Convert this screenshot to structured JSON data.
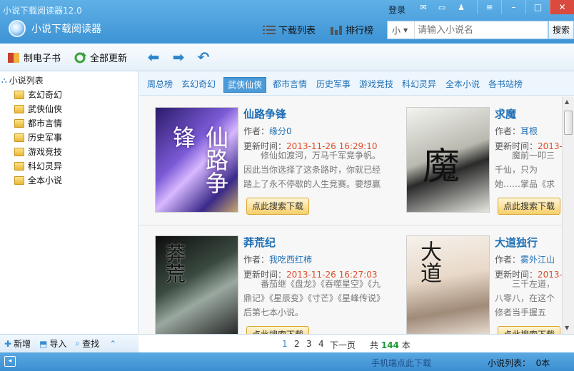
{
  "app": {
    "title": "小说下载阅读器12.0",
    "logo_text": "小说下载阅读器"
  },
  "topbar": {
    "login": "登录",
    "download_list": "下载列表",
    "ranking": "排行榜"
  },
  "search": {
    "type": "小",
    "placeholder": "请输入小说名",
    "button": "搜索"
  },
  "toolbar": {
    "make_ebook": "制电子书",
    "update_all": "全部更新"
  },
  "tree": {
    "root": "小说列表",
    "items": [
      "玄幻奇幻",
      "武侠仙侠",
      "都市言情",
      "历史军事",
      "游戏竞技",
      "科幻灵异",
      "全本小说"
    ]
  },
  "sidebar_bottom": {
    "add": "新增",
    "import": "导入",
    "find": "查找"
  },
  "categories": [
    "周总榜",
    "玄幻奇幻",
    "武侠仙侠",
    "都市言情",
    "历史军事",
    "游戏竞技",
    "科幻灵异",
    "全本小说",
    "各书站榜"
  ],
  "active_category": "武侠仙侠",
  "labels": {
    "author": "作者：",
    "updated": "更新时间：",
    "download": "点此搜索下载"
  },
  "books": [
    {
      "title": "仙路争锋",
      "author": "缘分0",
      "updated": "2013-11-26 16:29:10",
      "desc": "修仙如渡河，万马千军竞争帆。因此当你选择了这条路时，你就已经踏上了永不停歇的人生竞赛。要想赢"
    },
    {
      "title": "求魔",
      "author": "耳根",
      "updated": "2013-",
      "desc": "魔前一叩三千仙，只为她……掌品《求魔》"
    },
    {
      "title": "莽荒纪",
      "author": "我吃西红柿",
      "updated": "2013-11-26 16:27:03",
      "desc": "番茄继《盘龙》《吞噬星空》《九鼎记》《星辰变》《寸芒》《星峰传说》后第七本小说。"
    },
    {
      "title": "大道独行",
      "author": "雾外江山",
      "updated": "2013-",
      "desc": "三千左道，八零八，在这个修者当手握五行，脚踏"
    }
  ],
  "pager": {
    "pages": [
      "1",
      "2",
      "3",
      "4"
    ],
    "next": "下一页",
    "total_prefix": "共",
    "total": "144",
    "total_suffix": "本"
  },
  "status": {
    "mobile_download": "手机端点此下载",
    "list_count": "小说列表：  0本"
  },
  "colors": {
    "accent": "#3d93d4",
    "link": "#1e6fb5",
    "time": "#e04d2a",
    "button": "#f7cf6a"
  }
}
